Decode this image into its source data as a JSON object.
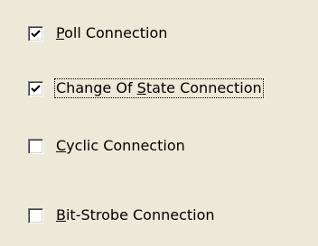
{
  "connections": [
    {
      "id": "poll",
      "checked": true,
      "mnemonic": "P",
      "rest": "oll Connection",
      "prefix": ""
    },
    {
      "id": "cos",
      "checked": true,
      "prefix": "Change Of ",
      "mnemonic": "S",
      "rest": "tate Connection"
    },
    {
      "id": "cyclic",
      "checked": false,
      "prefix": "",
      "mnemonic": "C",
      "rest": "yclic Connection"
    },
    {
      "id": "bitstrobe",
      "checked": false,
      "prefix": "",
      "mnemonic": "B",
      "rest": "it-Strobe Connection"
    }
  ]
}
